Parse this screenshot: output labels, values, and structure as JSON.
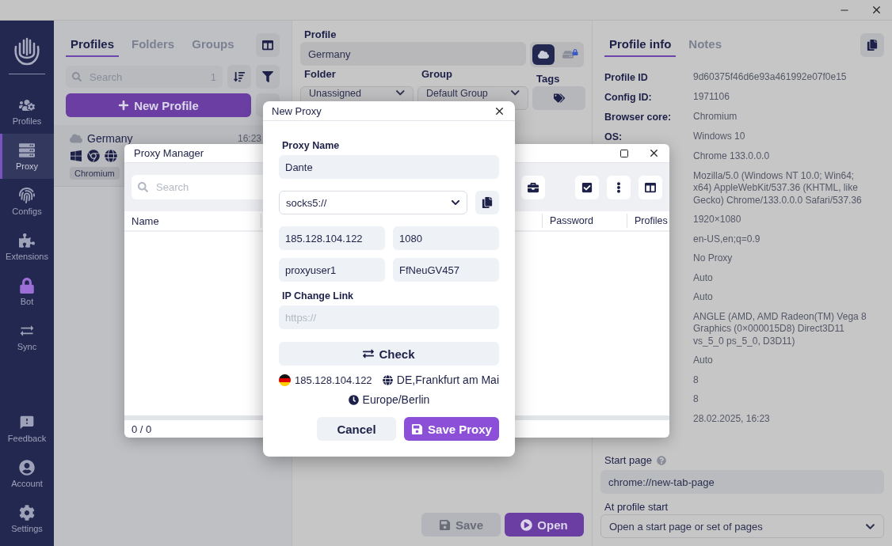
{
  "sidebar": {
    "items": [
      {
        "kind": "profiles",
        "label": "Profiles",
        "selected": false
      },
      {
        "kind": "proxy",
        "label": "Proxy",
        "selected": true
      },
      {
        "kind": "configs",
        "label": "Configs",
        "selected": false
      },
      {
        "kind": "extensions",
        "label": "Extensions",
        "selected": false
      },
      {
        "kind": "bot",
        "label": "Bot",
        "selected": false
      },
      {
        "kind": "sync",
        "label": "Sync",
        "selected": false
      }
    ],
    "bottom_items": [
      {
        "kind": "feedback",
        "label": "Feedback",
        "selected": false
      },
      {
        "kind": "account",
        "label": "Account",
        "selected": false
      },
      {
        "kind": "settings",
        "label": "Settings",
        "selected": false
      }
    ]
  },
  "profiles_panel": {
    "tabs": [
      {
        "label": "Profiles",
        "selected": true
      },
      {
        "label": "Folders",
        "selected": false
      },
      {
        "label": "Groups",
        "selected": false
      }
    ],
    "search": {
      "placeholder": "Search",
      "count": "1"
    },
    "new_profile_button": "New Profile",
    "profiles": [
      {
        "name": "Germany",
        "time": "16:23",
        "browser": "Chromium"
      }
    ]
  },
  "profile_editor": {
    "profile_label": "Profile",
    "profile_name": "Germany",
    "storage": [
      {
        "kind": "cloud",
        "selected": true
      },
      {
        "kind": "local",
        "selected": false
      }
    ],
    "folder_label": "Folder",
    "folder": "Unassigned",
    "group_label": "Group",
    "group": "Default Group",
    "tags_label": "Tags",
    "save_button": {
      "label": "Save",
      "disabled": true
    },
    "open_button": "Open"
  },
  "profile_info": {
    "tabs": [
      {
        "label": "Profile info",
        "selected": true
      },
      {
        "label": "Notes",
        "selected": false
      }
    ],
    "rows": [
      {
        "label": "Profile ID",
        "value": "9d60375f46d6e93a461992e07f0e15"
      },
      {
        "label": "Config ID:",
        "value": "1971106"
      },
      {
        "label": "Browser core:",
        "value": "Chromium"
      },
      {
        "label": "OS:",
        "value": "Windows 10"
      },
      {
        "value": "Chrome 133.0.0.0"
      },
      {
        "value": "Mozilla/5.0 (Windows NT 10.0; Win64; x64) AppleWebKit/537.36 (KHTML, like Gecko) Chrome/133.0.0.0 Safari/537.36"
      },
      {
        "value": "1920×1080"
      },
      {
        "value": "en-US,en;q=0.9"
      },
      {
        "value": "No Proxy"
      },
      {
        "value": "Auto"
      },
      {
        "value": "Auto"
      },
      {
        "value": "ANGLE (AMD, AMD Radeon(TM) Vega 8 Graphics (0×000015D8) Direct3D11 vs_5_0 ps_5_0, D3D11)"
      },
      {
        "value": "Auto"
      },
      {
        "value": "8"
      },
      {
        "value": "8"
      },
      {
        "value": "28.02.2025, 16:23"
      }
    ],
    "start_page_label": "Start page",
    "start_page": "chrome://new-tab-page",
    "at_profile_start_label": "At profile start",
    "at_profile_start": "Open a start page or set of pages"
  },
  "proxy_manager": {
    "title": "Proxy Manager",
    "search": {
      "placeholder": "Search"
    },
    "columns": [
      "Name",
      "Password",
      "Profiles"
    ],
    "footer": "0 / 0"
  },
  "new_proxy_dialog": {
    "title": "New Proxy",
    "name_label": "Proxy Name",
    "name": "Dante",
    "protocol": "socks5://",
    "host": "185.128.104.122",
    "port": "1080",
    "username": "proxyuser1",
    "password": "FfNeuGV457",
    "ip_change_label": "IP Change Link",
    "ip_change_placeholder": "https://",
    "check_button": "Check",
    "result": {
      "ip": "185.128.104.122",
      "location": "DE,Frankfurt am Mai",
      "timezone": "Europe/Berlin"
    },
    "cancel_button": "Cancel",
    "save_button": "Save Proxy"
  }
}
